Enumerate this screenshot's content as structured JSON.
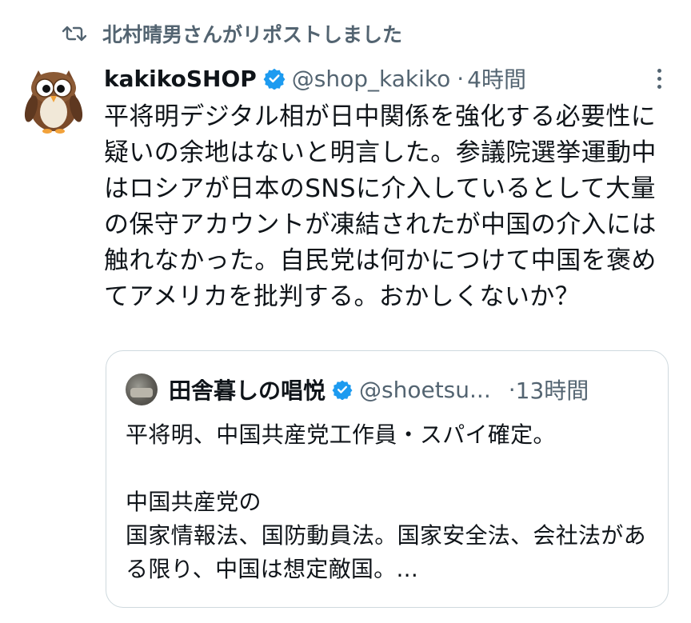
{
  "repost": {
    "label": "北村晴男さんがリポストしました",
    "icon": "repost-icon"
  },
  "tweet": {
    "display_name": "kakikoSHOP",
    "handle": "@shop_kakiko",
    "separator": "·",
    "time": "4時間",
    "text": "平将明デジタル相が日中関係を強化する必要性に疑いの余地はないと明言した。参議院選挙運動中はロシアが日本のSNSに介入しているとして大量の保守アカウントが凍結されたが中国の介入には触れなかった。自民党は何かにつけて中国を褒めてアメリカを批判する。おかしくないか？"
  },
  "quote": {
    "display_name": "田舎暮しの唱悦",
    "handle": "@shoetsu...",
    "separator": "·",
    "time": "13時間",
    "line1": "平将明、中国共産党工作員・スパイ確定。",
    "line2": "中国共産党の",
    "line3": "国家情報法、国防動員法。国家安全法、会社法がある限り、中国は想定敵国。..."
  },
  "colors": {
    "verified": "#1d9bf0",
    "secondary_text": "#536471",
    "primary_text": "#0f1419",
    "border": "#cfd9de"
  }
}
